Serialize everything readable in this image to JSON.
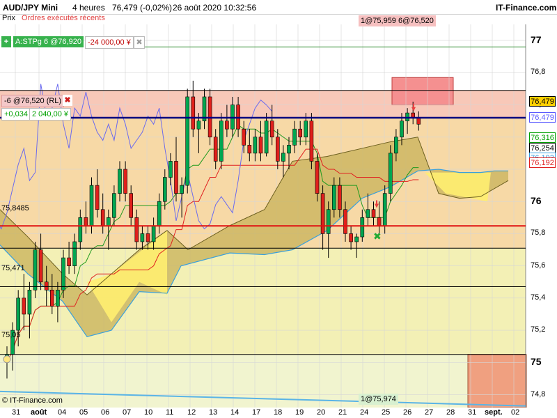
{
  "header": {
    "instrument": "AUD/JPY Mini",
    "timeframe": "4 heures",
    "quote": "76,479 (-0,02%)",
    "datetime": "26 août 2020 10:32:56",
    "brand": "IT-Finance.com"
  },
  "tabs": [
    {
      "label": "Prix"
    },
    {
      "label": "Ordres exécutés récents"
    }
  ],
  "order_panel": {
    "stop_label": "A:STPg  6 @76,920",
    "stop_amount": "-24 000,00 ¥",
    "position_label": "-6 @76,520 (RL)",
    "pnl_points": "+0,034",
    "pnl_amount": "2 040,00 ¥"
  },
  "top_order_tag": "1@75,959  6@76,520",
  "bottom_order_tag": "1@75,974",
  "copyright": "© IT-Finance.com",
  "left_levels": [
    "75,8485",
    "75,471",
    "75,05"
  ],
  "price_boxes": [
    {
      "value": "76,479",
      "bg": "#ffd000",
      "fg": "#000000"
    },
    {
      "value": "76,479",
      "bg": "#ffffff",
      "fg": "#5a5aff"
    },
    {
      "value": "76,316",
      "bg": "#ffffff",
      "fg": "#00a000"
    },
    {
      "value": "76,254",
      "bg": "#ffffff",
      "fg": "#000000"
    },
    {
      "value": "76,193",
      "bg": "#ffffff",
      "fg": "#3aa0e0"
    },
    {
      "value": "76,192",
      "bg": "#ffffff",
      "fg": "#e02020"
    }
  ],
  "colors": {
    "bull": "#00a651",
    "bear": "#e0201c",
    "tenkan": "#e02020",
    "kijun": "#1f9a1f",
    "chikou": "#6a6aee",
    "ssb": "#39a0dc",
    "cloud_bull": "#c8b25a",
    "cloud_bear": "#ffee70",
    "position_line": "#000080",
    "level_red": "#e01010"
  },
  "chart_data": {
    "type": "candlestick",
    "title": "AUD/JPY Mini",
    "yticks": [
      "77",
      "76,8",
      "76,6",
      "76,4",
      "76",
      "75,8",
      "75,6",
      "75,4",
      "75,2",
      "75",
      "74,8"
    ],
    "ylim": [
      74.72,
      77.12
    ],
    "xticks": [
      "31",
      "août",
      "04",
      "05",
      "06",
      "07",
      "10",
      "11",
      "12",
      "13",
      "14",
      "17",
      "18",
      "19",
      "20",
      "21",
      "24",
      "25",
      "26",
      "27",
      "28",
      "31",
      "sept.",
      "02"
    ],
    "ohlc": [
      [
        75.0,
        75.1,
        74.9,
        75.05
      ],
      [
        75.05,
        75.25,
        74.95,
        75.2
      ],
      [
        75.2,
        75.45,
        75.1,
        75.4
      ],
      [
        75.4,
        75.55,
        75.2,
        75.3
      ],
      [
        75.3,
        75.5,
        75.15,
        75.45
      ],
      [
        75.45,
        75.75,
        75.4,
        75.7
      ],
      [
        75.7,
        75.8,
        75.45,
        75.5
      ],
      [
        75.5,
        75.6,
        75.35,
        75.45
      ],
      [
        75.45,
        75.55,
        75.3,
        75.35
      ],
      [
        75.35,
        75.5,
        75.25,
        75.45
      ],
      [
        75.45,
        75.7,
        75.4,
        75.65
      ],
      [
        75.65,
        75.75,
        75.55,
        75.6
      ],
      [
        75.6,
        75.8,
        75.55,
        75.75
      ],
      [
        75.75,
        75.95,
        75.7,
        75.9
      ],
      [
        75.9,
        76.0,
        75.8,
        75.85
      ],
      [
        75.85,
        76.15,
        75.8,
        76.1
      ],
      [
        76.1,
        76.2,
        75.9,
        75.95
      ],
      [
        75.95,
        76.05,
        75.8,
        75.85
      ],
      [
        75.85,
        75.95,
        75.7,
        75.9
      ],
      [
        75.9,
        76.1,
        75.85,
        76.05
      ],
      [
        76.05,
        76.25,
        76.0,
        76.2
      ],
      [
        76.2,
        76.25,
        76.0,
        76.05
      ],
      [
        76.05,
        76.1,
        75.85,
        75.9
      ],
      [
        75.9,
        75.95,
        75.7,
        75.75
      ],
      [
        75.75,
        75.85,
        75.7,
        75.8
      ],
      [
        75.8,
        75.85,
        75.7,
        75.75
      ],
      [
        75.75,
        75.9,
        75.7,
        75.85
      ],
      [
        75.85,
        76.05,
        75.8,
        76.0
      ],
      [
        76.0,
        76.2,
        75.95,
        76.15
      ],
      [
        76.15,
        76.3,
        76.1,
        76.25
      ],
      [
        76.25,
        76.4,
        76.0,
        76.05
      ],
      [
        76.05,
        76.15,
        75.9,
        76.1
      ],
      [
        76.1,
        76.7,
        76.05,
        76.65
      ],
      [
        76.65,
        76.75,
        76.4,
        76.45
      ],
      [
        76.45,
        76.55,
        76.3,
        76.5
      ],
      [
        76.5,
        76.7,
        76.45,
        76.65
      ],
      [
        76.65,
        76.7,
        76.35,
        76.4
      ],
      [
        76.4,
        76.45,
        76.2,
        76.25
      ],
      [
        76.25,
        76.55,
        76.2,
        76.5
      ],
      [
        76.5,
        76.6,
        76.4,
        76.45
      ],
      [
        76.45,
        76.65,
        76.4,
        76.6
      ],
      [
        76.6,
        76.65,
        76.4,
        76.45
      ],
      [
        76.45,
        76.5,
        76.3,
        76.35
      ],
      [
        76.35,
        76.45,
        76.25,
        76.3
      ],
      [
        76.3,
        76.45,
        76.25,
        76.4
      ],
      [
        76.4,
        76.5,
        76.25,
        76.3
      ],
      [
        76.3,
        76.55,
        76.28,
        76.5
      ],
      [
        76.5,
        76.6,
        76.35,
        76.4
      ],
      [
        76.4,
        76.45,
        76.2,
        76.25
      ],
      [
        76.25,
        76.35,
        76.15,
        76.3
      ],
      [
        76.3,
        76.4,
        76.2,
        76.35
      ],
      [
        76.35,
        76.5,
        76.3,
        76.45
      ],
      [
        76.45,
        76.5,
        76.35,
        76.4
      ],
      [
        76.4,
        76.55,
        76.35,
        76.5
      ],
      [
        76.5,
        76.55,
        76.2,
        76.25
      ],
      [
        76.25,
        76.3,
        76.0,
        76.05
      ],
      [
        76.05,
        76.1,
        75.7,
        75.8
      ],
      [
        75.8,
        76.0,
        75.65,
        75.95
      ],
      [
        75.95,
        76.15,
        75.9,
        76.1
      ],
      [
        76.1,
        76.15,
        75.9,
        75.95
      ],
      [
        75.95,
        76.0,
        75.75,
        75.8
      ],
      [
        75.8,
        75.85,
        75.7,
        75.75
      ],
      [
        75.75,
        75.8,
        75.65,
        75.78
      ],
      [
        75.78,
        75.95,
        75.75,
        75.9
      ],
      [
        75.9,
        76.05,
        75.85,
        75.95
      ],
      [
        75.95,
        76.0,
        75.85,
        75.9
      ],
      [
        75.9,
        76.0,
        75.8,
        75.85
      ],
      [
        75.85,
        76.1,
        75.8,
        76.05
      ],
      [
        76.05,
        76.35,
        76.0,
        76.3
      ],
      [
        76.3,
        76.45,
        76.25,
        76.4
      ],
      [
        76.4,
        76.55,
        76.35,
        76.5
      ],
      [
        76.5,
        76.58,
        76.42,
        76.55
      ],
      [
        76.55,
        76.62,
        76.48,
        76.52
      ],
      [
        76.52,
        76.56,
        76.44,
        76.48
      ]
    ],
    "position_level": 76.52,
    "red_level": 75.8485,
    "levels": [
      75.471,
      75.05
    ],
    "annotations": [
      "75,8485",
      "75,471",
      "75,05",
      "1@75,959  6@76,520",
      "1@75,974"
    ]
  }
}
